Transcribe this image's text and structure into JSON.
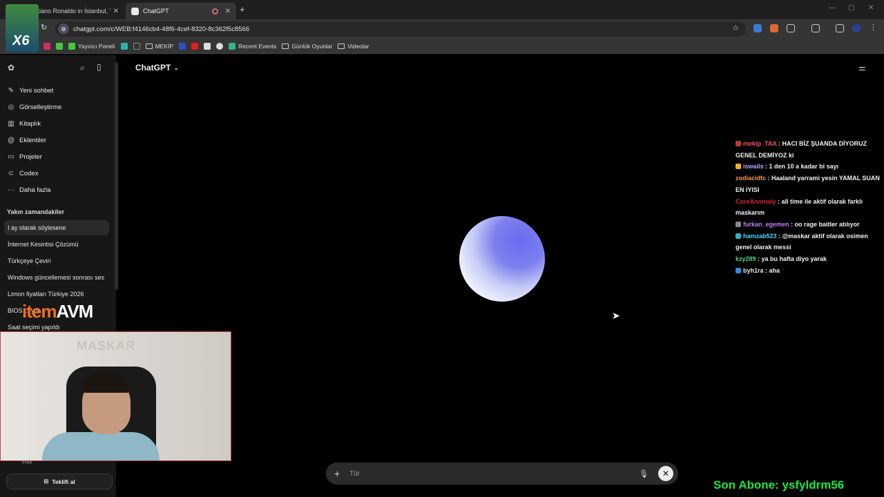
{
  "browser": {
    "tabs": [
      {
        "title": "istiano Ronaldo in İstanbul, T"
      },
      {
        "title": "ChatGPT"
      }
    ],
    "new_tab": "+",
    "reload": "↻",
    "url": "chatgpt.com/c/WEB:f4146cb4-48f6-4cef-8320-8c362f5c8566",
    "bookmarks": [
      {
        "label": "Yayıncı Paneli",
        "icon": "k-icon"
      },
      {
        "label": "MEKİP",
        "icon": "folder-icon"
      },
      {
        "label": "Recent Events",
        "icon": "app-icon"
      },
      {
        "label": "Günlük Oyunlar",
        "icon": "folder-icon"
      },
      {
        "label": "Videolar",
        "icon": "folder-icon"
      }
    ]
  },
  "sidebar": {
    "nav": [
      {
        "label": "Yeni sohbet",
        "icon": "edit-icon"
      },
      {
        "label": "Görselleştirme",
        "icon": "image-icon"
      },
      {
        "label": "Kitaplık",
        "icon": "library-icon"
      },
      {
        "label": "Eklentiler",
        "icon": "plugin-icon"
      },
      {
        "label": "Projeler",
        "icon": "folder-icon"
      },
      {
        "label": "Codex",
        "icon": "codex-icon"
      },
      {
        "label": "Daha fazla",
        "icon": "more-icon"
      }
    ],
    "recent_title": "Yakın zamandakiler",
    "recent": [
      "I ay olarak söylesene",
      "İnternet Kesintisi Çözümü",
      "Türkçeye Çeviri",
      "Windows güncellemesi sonrası ses",
      "Limon fiyatları Türkiye 2026",
      "BIOS ... yol",
      "Saat seçimi yapıldı"
    ],
    "plan_label": "Free",
    "upgrade_label": "Teklifi al"
  },
  "overlay": {
    "logo_text": "X6",
    "sponsor_prefix": "item",
    "sponsor_suffix": "AVM",
    "webcam_watermark": "MASKAR",
    "last_sub": "Son Abone: ysfyldrm56"
  },
  "main": {
    "title": "ChatGPT",
    "composer_placeholder": "Tür"
  },
  "chat": [
    {
      "user": "mekip_TAA",
      "color": "#ff4a6a",
      "text": " : HACI BİZ ŞUANDA DİYORUZ GENEL DEMİYOZ ki",
      "badge": "#c03a3a"
    },
    {
      "user": "iswails",
      "color": "#b8a6ff",
      "text": " : 1 den 10 a kadar bi sayı",
      "badge": "#f0b020"
    },
    {
      "user": "zodiacidfc",
      "color": "#f29b3a",
      "text": " : Haaland yarrami yesin YAMAL SUAN EN IYISI",
      "badge": ""
    },
    {
      "user": "CoreAnomaly",
      "color": "#d0283a",
      "text": " : all time ile aktif olarak farklı maskarım",
      "badge": ""
    },
    {
      "user": "furkan_egemen",
      "color": "#c77dff",
      "text": " : oo rage baitler atılıyor",
      "badge": "#888888"
    },
    {
      "user": "hamzab523",
      "color": "#4ad9ff",
      "text": " : @maskar aktif olarak osimen genel olarak messi",
      "badge": "#2bb4c9",
      "mention": "@maskar"
    },
    {
      "user": "kzy289",
      "color": "#4cd48a",
      "text": " : ya bu hafta diyo yarak",
      "badge": ""
    },
    {
      "user": "byh1ra",
      "color": "#e6e6e6",
      "text": " : aha",
      "badge": "#2f8de0"
    }
  ]
}
